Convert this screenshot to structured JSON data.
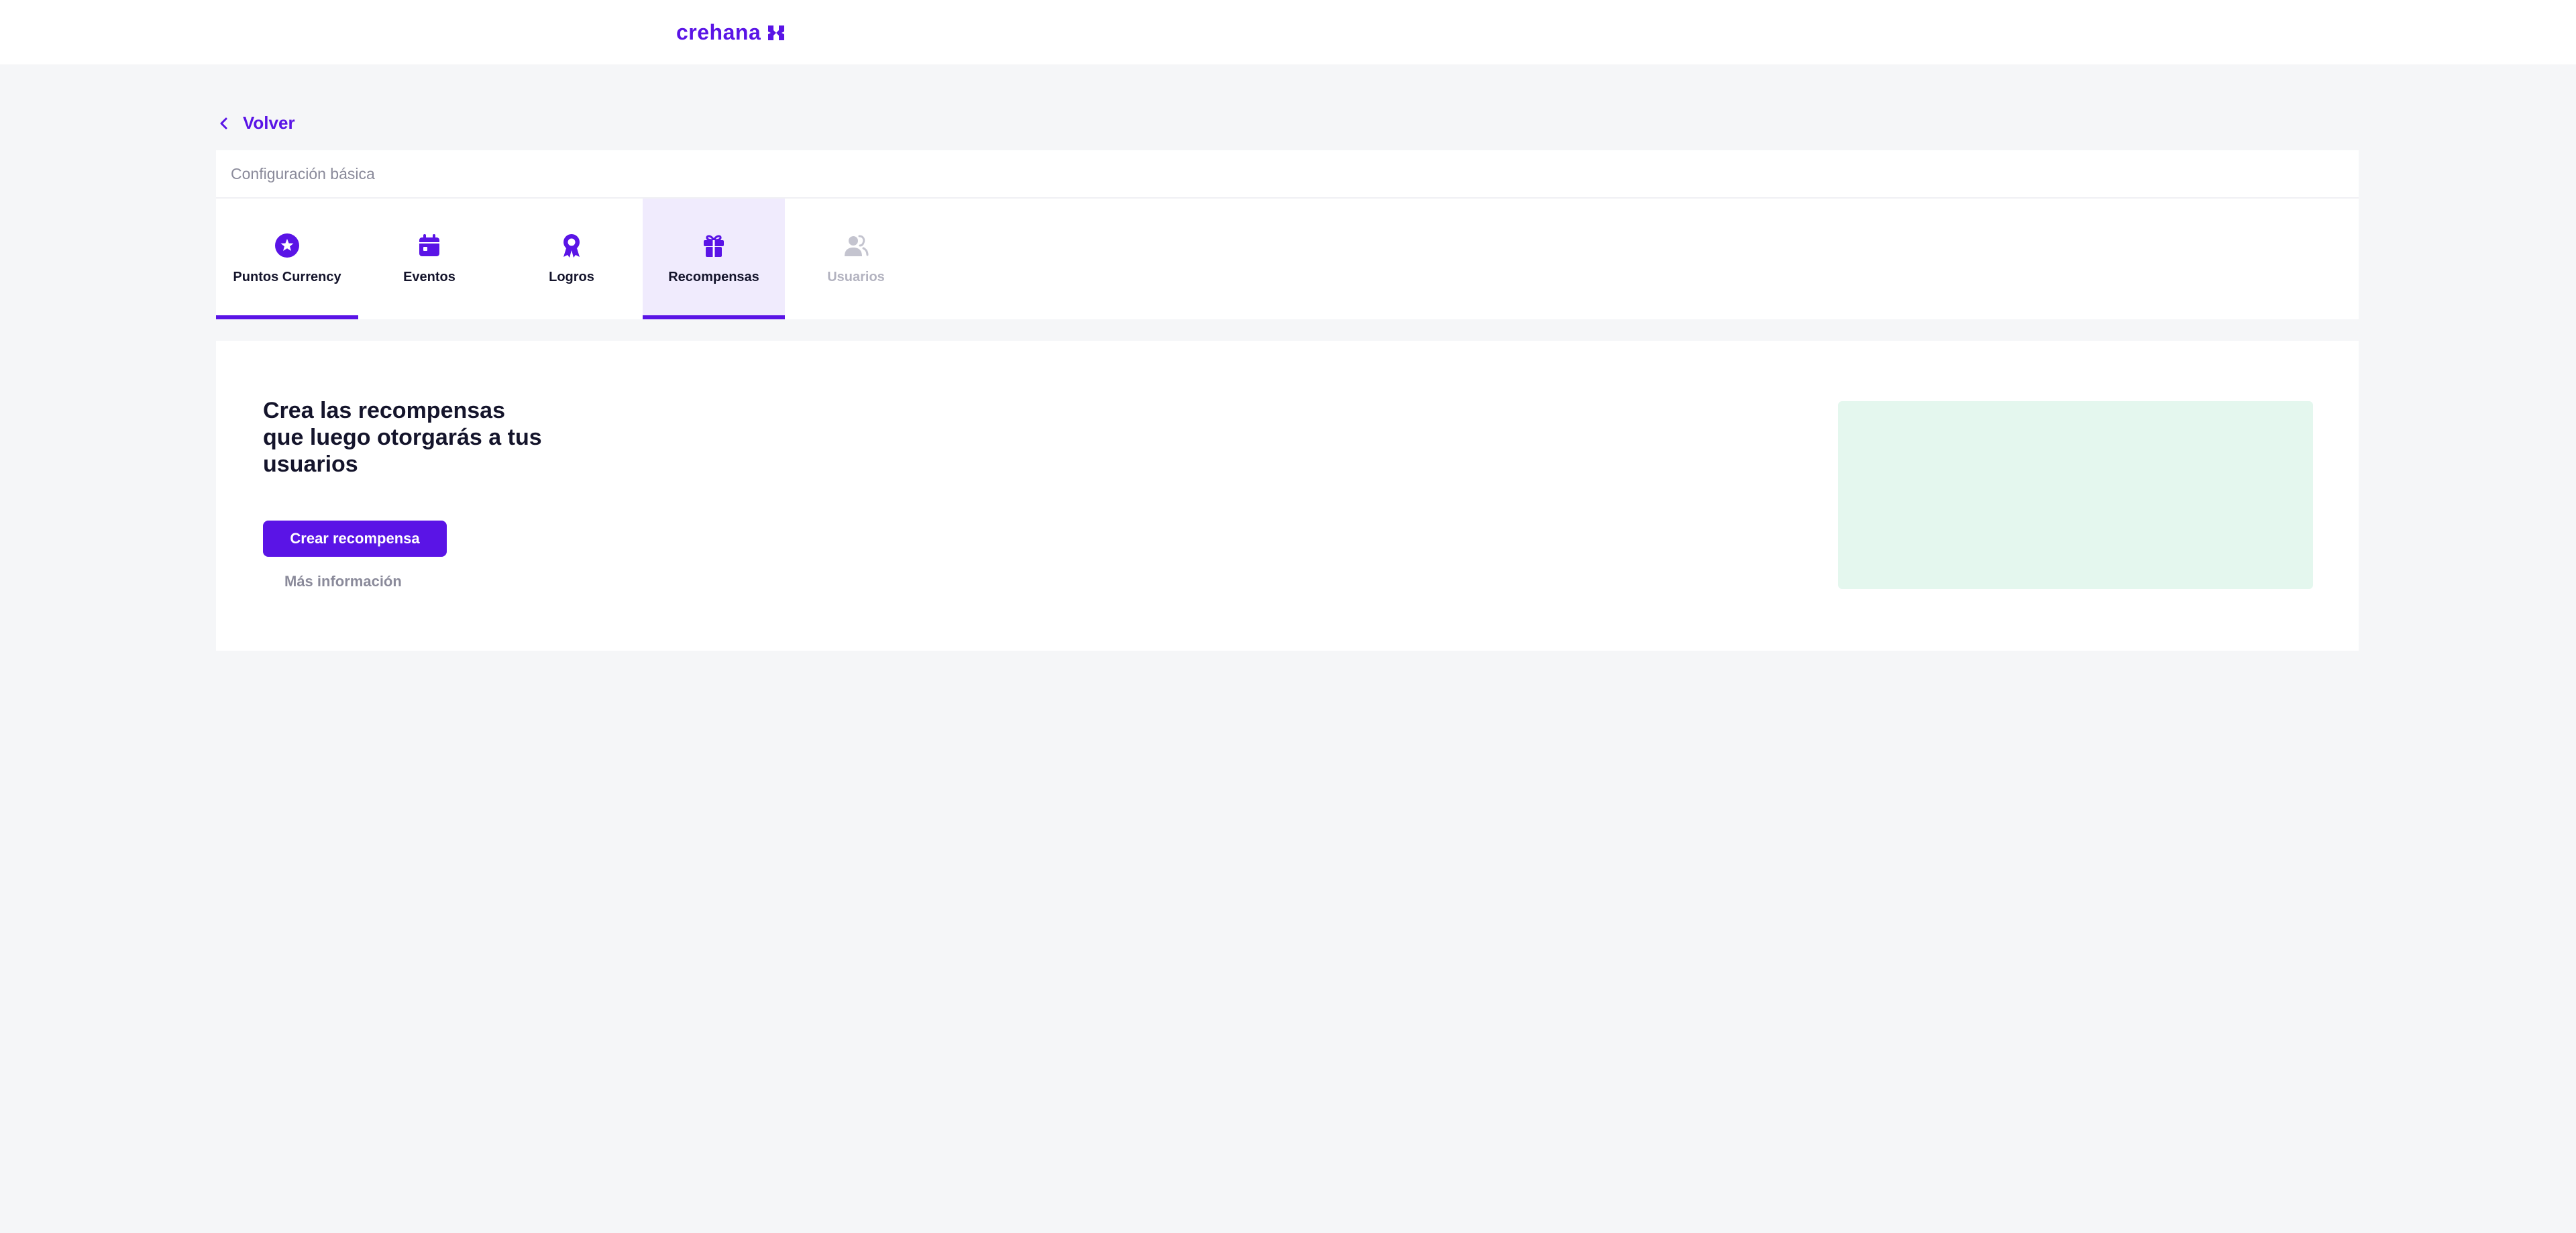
{
  "brand": {
    "name": "crehana",
    "color": "#5a14e6"
  },
  "nav": {
    "back_label": "Volver"
  },
  "config": {
    "title": "Configuración básica",
    "tabs": [
      {
        "label": "Puntos Currency",
        "icon": "star-circle-icon",
        "state": "completed"
      },
      {
        "label": "Eventos",
        "icon": "calendar-icon",
        "state": "default"
      },
      {
        "label": "Logros",
        "icon": "award-ribbon-icon",
        "state": "default"
      },
      {
        "label": "Recompensas",
        "icon": "gift-icon",
        "state": "active"
      },
      {
        "label": "Usuarios",
        "icon": "users-icon",
        "state": "disabled"
      }
    ]
  },
  "content": {
    "heading": "Crea las recompensas que luego otorgarás a tus usuarios",
    "primary_button": "Crear recompensa",
    "secondary_link": "Más información",
    "illustration_color": "#e4f7ee"
  }
}
